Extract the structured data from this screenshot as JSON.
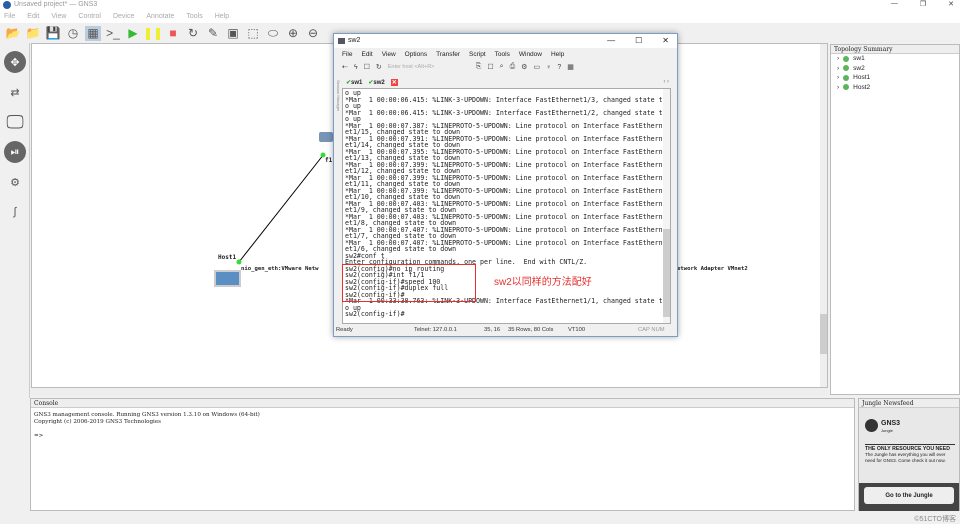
{
  "app": {
    "title": "Unsaved project* — GNS3",
    "menu": [
      "File",
      "Edit",
      "View",
      "Control",
      "Device",
      "Annotate",
      "Tools",
      "Help"
    ]
  },
  "canvas": {
    "host_label": "Host1",
    "sw_label": "s",
    "port_label": "f1",
    "link_left": "nio_gen_eth:VMware Netw",
    "link_right": "etwork Adapter VMnet2"
  },
  "topology": {
    "title": "Topology Summary",
    "items": [
      "sw1",
      "sw2",
      "Host1",
      "Host2"
    ]
  },
  "console": {
    "title": "Console",
    "lines": [
      "GNS3 management console. Running GNS3 version 1.3.10 on Windows (64-bit)",
      "Copyright (c) 2006-2019 GNS3 Technologies",
      "",
      "=>"
    ]
  },
  "jungle": {
    "title": "Jungle Newsfeed",
    "logo": "GNS3",
    "logo_sub": "Jungle",
    "headline": "THE ONLY RESOURCE YOU NEED",
    "text": "The Jungle has everything you will ever need for GNS3. Come check it out now.",
    "button": "Go to the Jungle"
  },
  "watermark": "©51CTO博客",
  "terminal": {
    "title": "sw2",
    "menu": [
      "File",
      "Edit",
      "View",
      "Options",
      "Transfer",
      "Script",
      "Tools",
      "Window",
      "Help"
    ],
    "host_placeholder": "Enter host <Alt+R>",
    "session_manager": "Session Manager",
    "tabs": [
      "sw1",
      "sw2"
    ],
    "lines": [
      "o up",
      "*Mar  1 00:00:06.415: %LINK-3-UPDOWN: Interface FastEthernet1/3, changed state t",
      "o up",
      "*Mar  1 00:00:06.415: %LINK-3-UPDOWN: Interface FastEthernet1/2, changed state t",
      "o up",
      "*Mar  1 00:00:07.387: %LINEPROTO-5-UPDOWN: Line protocol on Interface FastEthern",
      "et1/15, changed state to down",
      "*Mar  1 00:00:07.391: %LINEPROTO-5-UPDOWN: Line protocol on Interface FastEthern",
      "et1/14, changed state to down",
      "*Mar  1 00:00:07.395: %LINEPROTO-5-UPDOWN: Line protocol on Interface FastEthern",
      "et1/13, changed state to down",
      "*Mar  1 00:00:07.399: %LINEPROTO-5-UPDOWN: Line protocol on Interface FastEthern",
      "et1/12, changed state to down",
      "*Mar  1 00:00:07.399: %LINEPROTO-5-UPDOWN: Line protocol on Interface FastEthern",
      "et1/11, changed state to down",
      "*Mar  1 00:00:07.399: %LINEPROTO-5-UPDOWN: Line protocol on Interface FastEthern",
      "et1/10, changed state to down",
      "*Mar  1 00:00:07.403: %LINEPROTO-5-UPDOWN: Line protocol on Interface FastEthern",
      "et1/9, changed state to down",
      "*Mar  1 00:00:07.403: %LINEPROTO-5-UPDOWN: Line protocol on Interface FastEthern",
      "et1/8, changed state to down",
      "*Mar  1 00:00:07.407: %LINEPROTO-5-UPDOWN: Line protocol on Interface FastEthern",
      "et1/7, changed state to down",
      "*Mar  1 00:00:07.407: %LINEPROTO-5-UPDOWN: Line protocol on Interface FastEthern",
      "et1/6, changed state to down",
      "sw2#conf t",
      "Enter configuration commands, one per line.  End with CNTL/Z.",
      "sw2(config)#no ip routing",
      "sw2(config)#int f1/1",
      "sw2(config-if)#speed 100",
      "sw2(config-if)#duplex full",
      "sw2(config-if)#",
      "*Mar  1 00:33:38.763: %LINK-3-UPDOWN: Interface FastEthernet1/1, changed state t",
      "o up",
      "sw2(config-if)#"
    ],
    "status": {
      "ready": "Ready",
      "conn": "Telnet: 127.0.0.1",
      "pos": "35, 16",
      "size": "35 Rows, 80 Cols",
      "term": "VT100",
      "caps": "CAP NUM"
    },
    "annotation": "sw2以同样的方法配好"
  }
}
